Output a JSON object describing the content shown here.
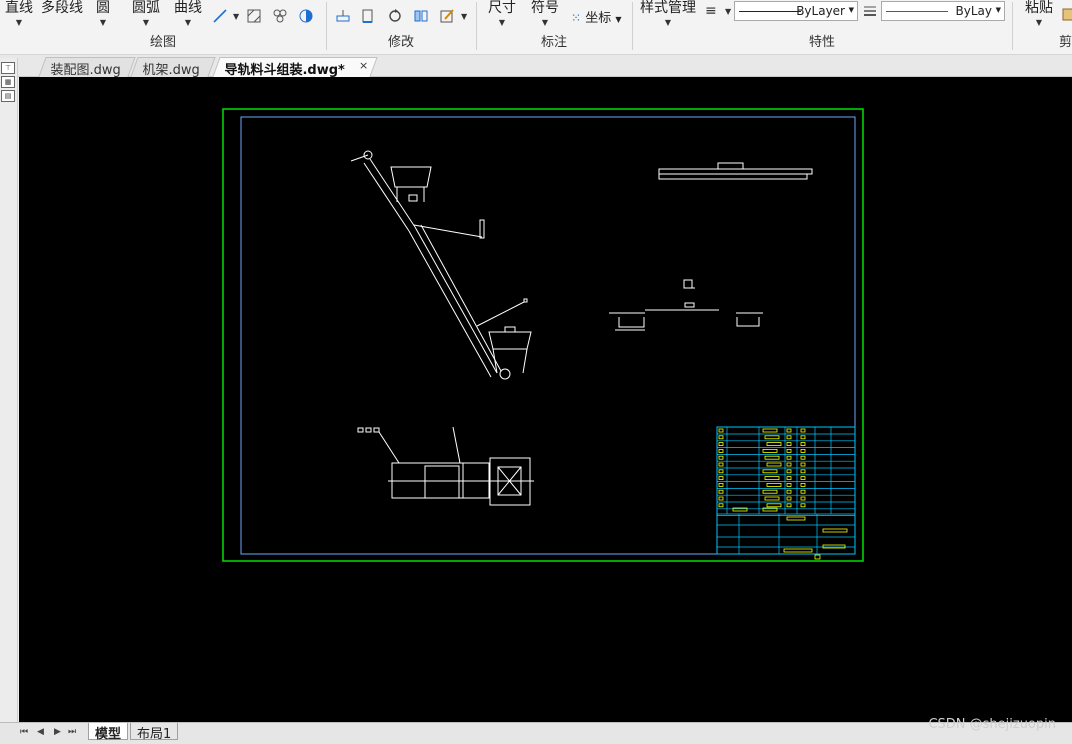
{
  "ribbon": {
    "draw": {
      "line_label": "直线",
      "polyline_label": "多段线",
      "circle_label": "圆",
      "arc_label": "圆弧",
      "curve_label": "曲线",
      "group_label": "绘图"
    },
    "modify": {
      "group_label": "修改"
    },
    "annotate": {
      "dimension_label": "尺寸",
      "symbol_label": "符号",
      "coordinate_label": "坐标",
      "group_label": "标注"
    },
    "properties": {
      "style_manager_label": "样式管理",
      "linetype_value": "ByLayer",
      "lineweight_value": "ByLay",
      "group_label": "特性"
    },
    "clipboard": {
      "paste_label": "粘贴",
      "cut_partial_label": "剪"
    }
  },
  "tabs": [
    {
      "label": "装配图.dwg"
    },
    {
      "label": "机架.dwg"
    },
    {
      "label": "导轨料斗组装.dwg*"
    }
  ],
  "tab_close_glyph": "×",
  "layout_tabs": [
    {
      "label": "模型"
    },
    {
      "label": "布局1"
    }
  ],
  "nav_glyphs": {
    "first": "⏮",
    "prev": "◀",
    "next": "▶",
    "last": "⏭"
  },
  "watermark": "CSDN @shejizuopin",
  "colors": {
    "canvas_bg": "#000000",
    "outer_border": "#00e000",
    "inner_border": "#6aa8ff",
    "drawing_lines": "#ffffff",
    "table_lines": "#00c8ff",
    "table_text": "#ffff00",
    "linetype_red": "#e02020"
  },
  "icons": {
    "line_dropdown": "chevron-down-icon",
    "properties_list": "list-icon",
    "coordinate": "coordinate-icon"
  }
}
